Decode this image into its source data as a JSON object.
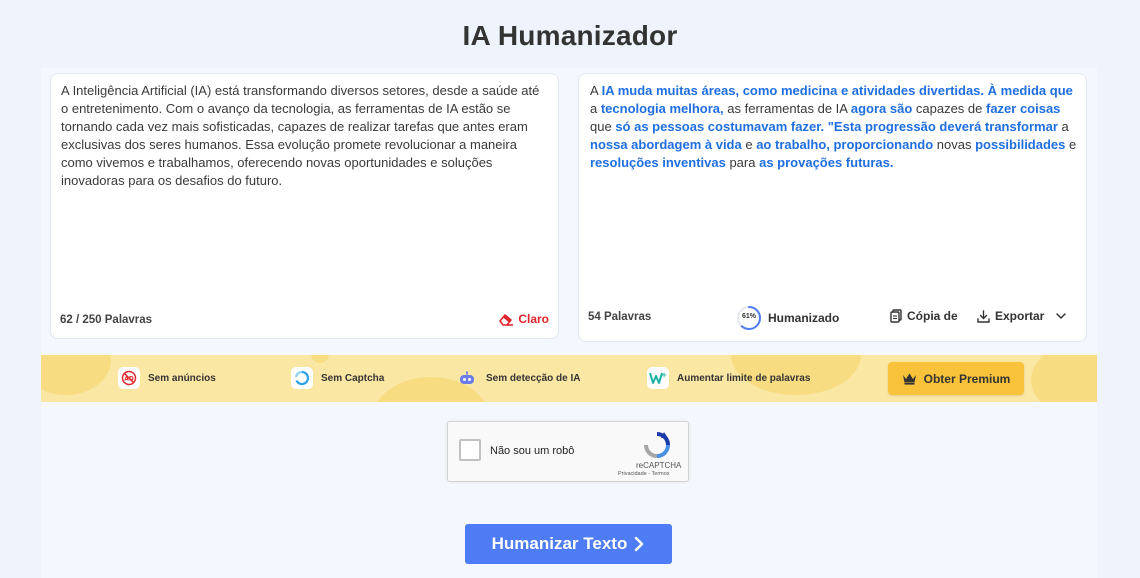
{
  "page": {
    "title": "IA Humanizador"
  },
  "input_panel": {
    "text": "A Inteligência Artificial (IA) está transformando diversos setores, desde a saúde até o entretenimento. Com o avanço da tecnologia, as ferramentas de IA estão se tornando cada vez mais sofisticadas, capazes de realizar tarefas que antes eram exclusivas dos seres humanos. Essa evolução promete revolucionar a maneira como vivemos e trabalhamos, oferecendo novas oportunidades e soluções inovadoras para os desafios do futuro.",
    "word_count": "62 / 250 Palavras",
    "clear_label": "Claro",
    "clear_icon": "eraser-icon"
  },
  "output_panel": {
    "segments": [
      {
        "t": "A ",
        "h": false
      },
      {
        "t": "IA muda muitas áreas, como medicina e atividades divertidas.  À medida que",
        "h": true
      },
      {
        "t": " a ",
        "h": false
      },
      {
        "t": "tecnologia melhora,",
        "h": true
      },
      {
        "t": " as ferramentas de IA ",
        "h": false
      },
      {
        "t": "agora são",
        "h": true
      },
      {
        "t": " capazes de ",
        "h": false
      },
      {
        "t": "fazer coisas",
        "h": true
      },
      {
        "t": " que ",
        "h": false
      },
      {
        "t": "só as pessoas costumavam fazer.  \"Esta progressão deverá transformar",
        "h": true
      },
      {
        "t": " a ",
        "h": false
      },
      {
        "t": "nossa abordagem à vida",
        "h": true
      },
      {
        "t": " e ",
        "h": false
      },
      {
        "t": "ao trabalho, proporcionando",
        "h": true
      },
      {
        "t": " novas ",
        "h": false
      },
      {
        "t": "possibilidades",
        "h": true
      },
      {
        "t": " e ",
        "h": false
      },
      {
        "t": "resoluções inventivas",
        "h": true
      },
      {
        "t": " para ",
        "h": false
      },
      {
        "t": "as provações futuras.",
        "h": true
      }
    ],
    "word_count": "54 Palavras",
    "humanized_percent": 61,
    "humanized_percent_label": "61%",
    "humanized_label": "Humanizado",
    "copy_label": "Cópia de",
    "export_label": "Exportar"
  },
  "banner": {
    "features": [
      {
        "label": "Sem anúncios",
        "icon": "no-ads-icon"
      },
      {
        "label": "Sem Captcha",
        "icon": "captcha-icon"
      },
      {
        "label": "Sem detecção de IA",
        "icon": "robot-icon"
      },
      {
        "label": "Aumentar limite de palavras",
        "icon": "word-limit-icon"
      }
    ],
    "premium_label": "Obter Premium",
    "premium_icon": "crown-icon"
  },
  "captcha": {
    "label": "Não sou um robô",
    "brand": "reCAPTCHA",
    "links": "Privacidade - Termos"
  },
  "action": {
    "label": "Humanizar Texto"
  },
  "colors": {
    "accent": "#4d7cf4",
    "highlight": "#1f6fe0",
    "danger": "#e0262d",
    "premium": "#f8c33a",
    "banner": "#fbe7a4"
  }
}
